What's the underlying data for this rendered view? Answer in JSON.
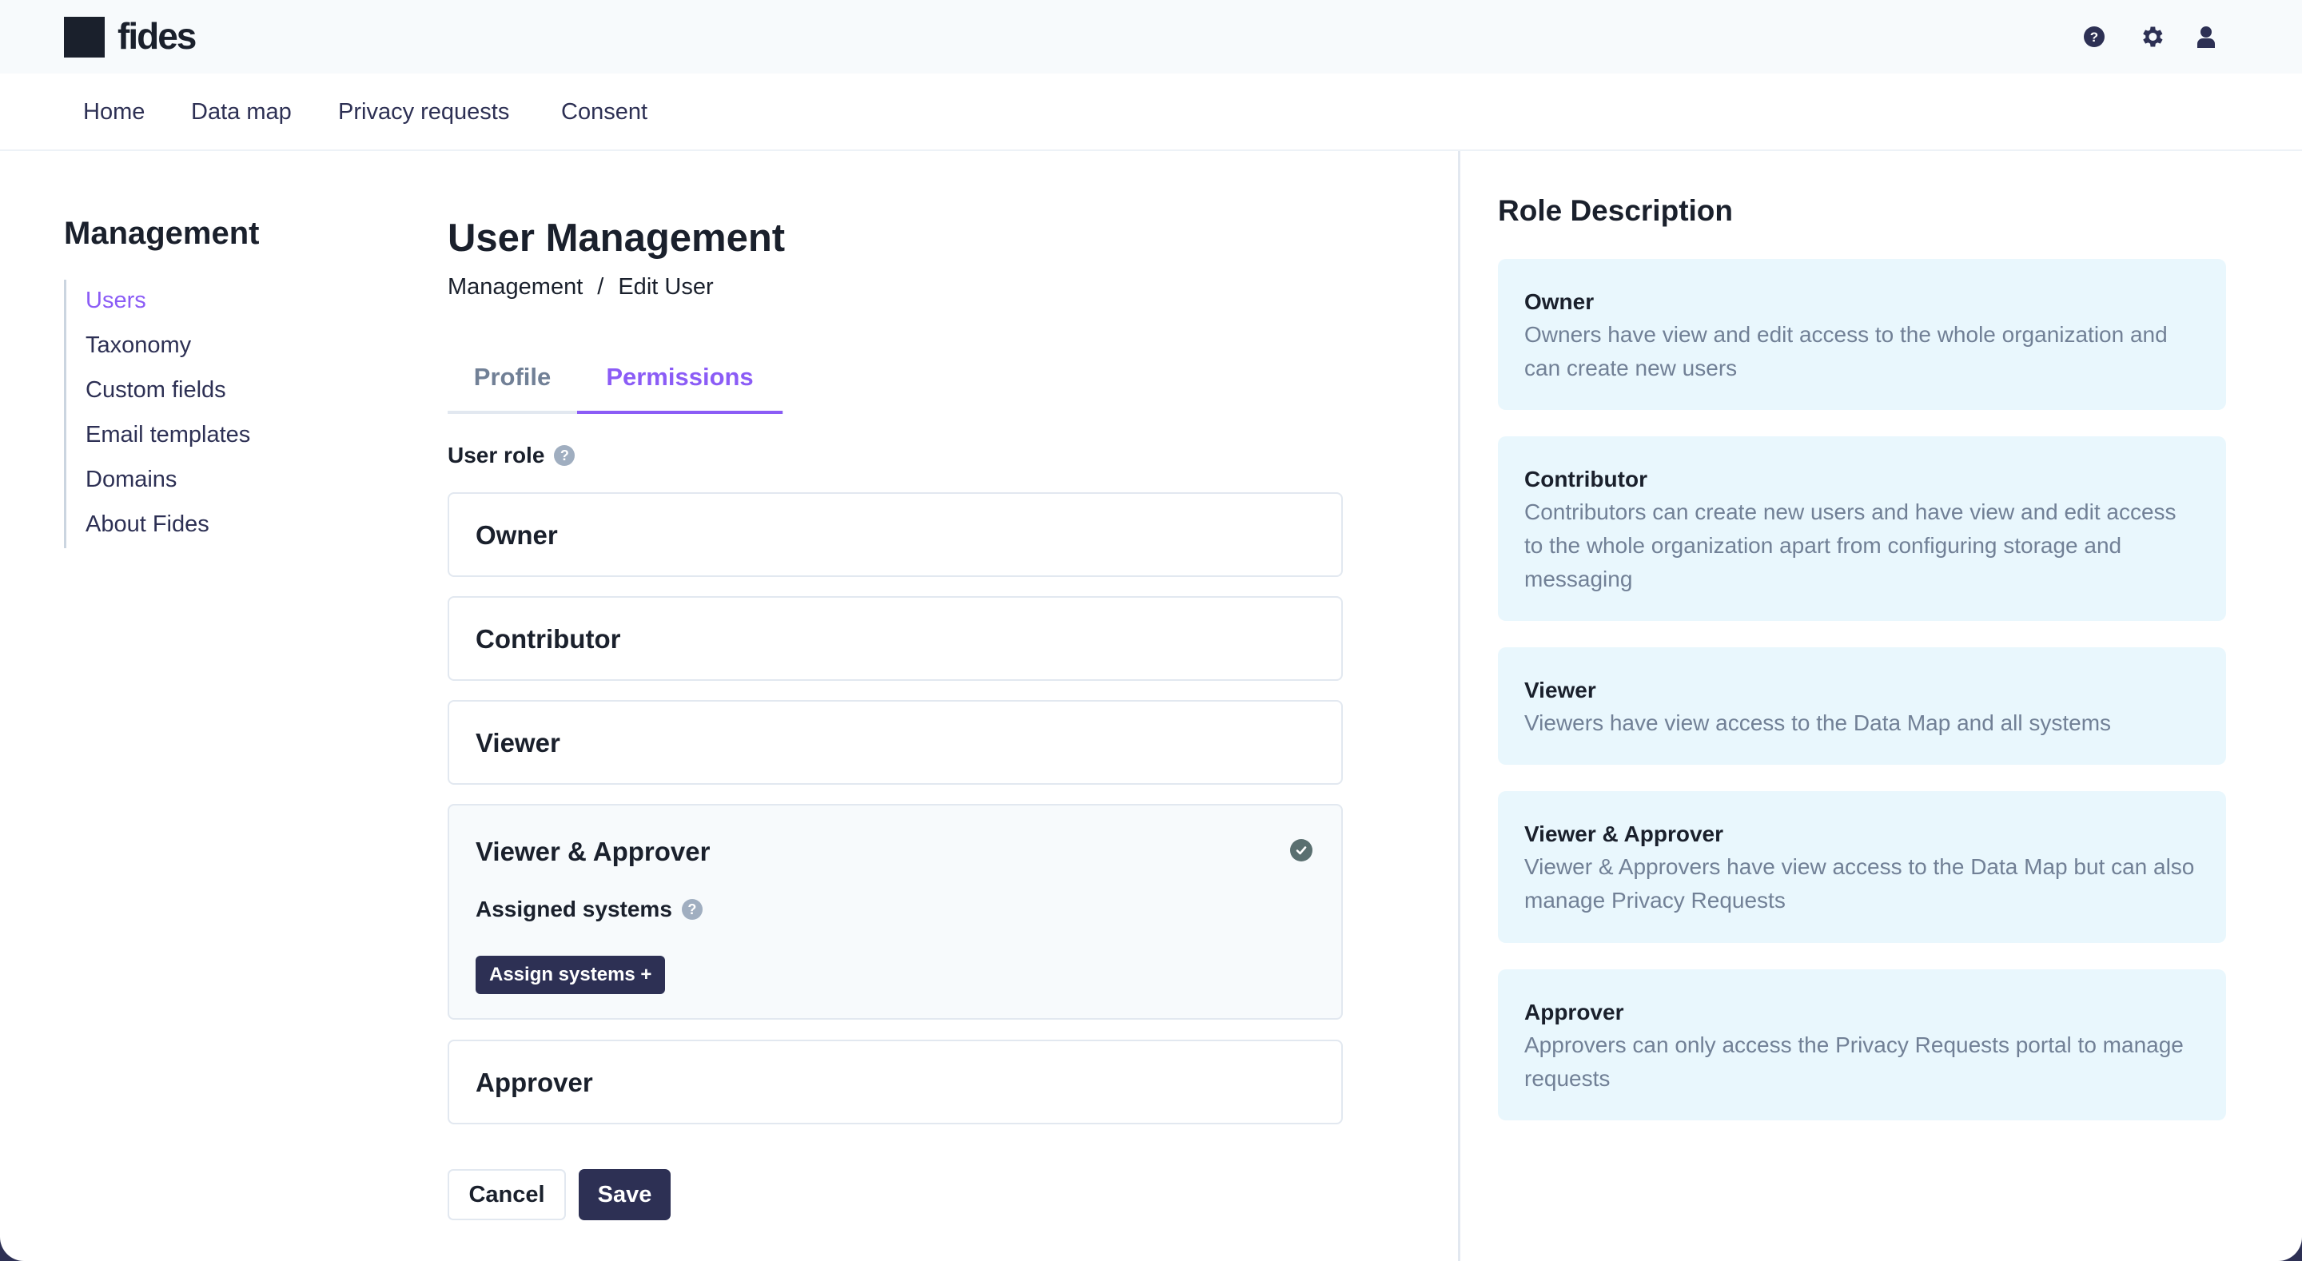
{
  "app": {
    "logo_text": "fides",
    "header_icons": [
      "help-icon",
      "settings-gear-icon",
      "user-account-icon"
    ]
  },
  "nav": {
    "items": [
      {
        "label": "Home"
      },
      {
        "label": "Data map"
      },
      {
        "label": "Privacy requests"
      },
      {
        "label": "Consent"
      }
    ]
  },
  "sidebar": {
    "title": "Management",
    "active": "Users",
    "items": [
      {
        "label": "Users"
      },
      {
        "label": "Taxonomy"
      },
      {
        "label": "Custom fields"
      },
      {
        "label": "Email templates"
      },
      {
        "label": "Domains"
      },
      {
        "label": "About Fides"
      }
    ]
  },
  "main": {
    "title": "User Management",
    "breadcrumb": {
      "parent": "Management",
      "separator": "/",
      "current": "Edit User"
    },
    "tabs": [
      {
        "label": "Profile",
        "active": false
      },
      {
        "label": "Permissions",
        "active": true
      }
    ],
    "user_role_label": "User role",
    "selected_role": "Viewer & Approver",
    "roles": [
      {
        "label": "Owner"
      },
      {
        "label": "Contributor"
      },
      {
        "label": "Viewer"
      },
      {
        "label": "Viewer & Approver"
      },
      {
        "label": "Approver"
      }
    ],
    "assigned_systems_label": "Assigned systems",
    "assign_systems_button": "Assign systems +",
    "cancel_label": "Cancel",
    "save_label": "Save"
  },
  "role_description": {
    "title": "Role Description",
    "items": [
      {
        "name": "Owner",
        "text": "Owners have view and edit access to the whole organization and can create new users"
      },
      {
        "name": "Contributor",
        "text": "Contributors can create new users and have view and edit access to the whole organization apart from configuring storage and messaging"
      },
      {
        "name": "Viewer",
        "text": "Viewers have view access to the Data Map and all systems"
      },
      {
        "name": "Viewer & Approver",
        "text": "Viewer & Approvers have view access to the Data Map but can also manage Privacy Requests"
      },
      {
        "name": "Approver",
        "text": "Approvers can only access the Privacy Requests portal to manage requests"
      }
    ]
  },
  "colors": {
    "accent": "#8B5CF6",
    "primary_button": "#2D3054",
    "description_card_bg": "#E9F7FD",
    "selected_check": "#5A6F70"
  }
}
